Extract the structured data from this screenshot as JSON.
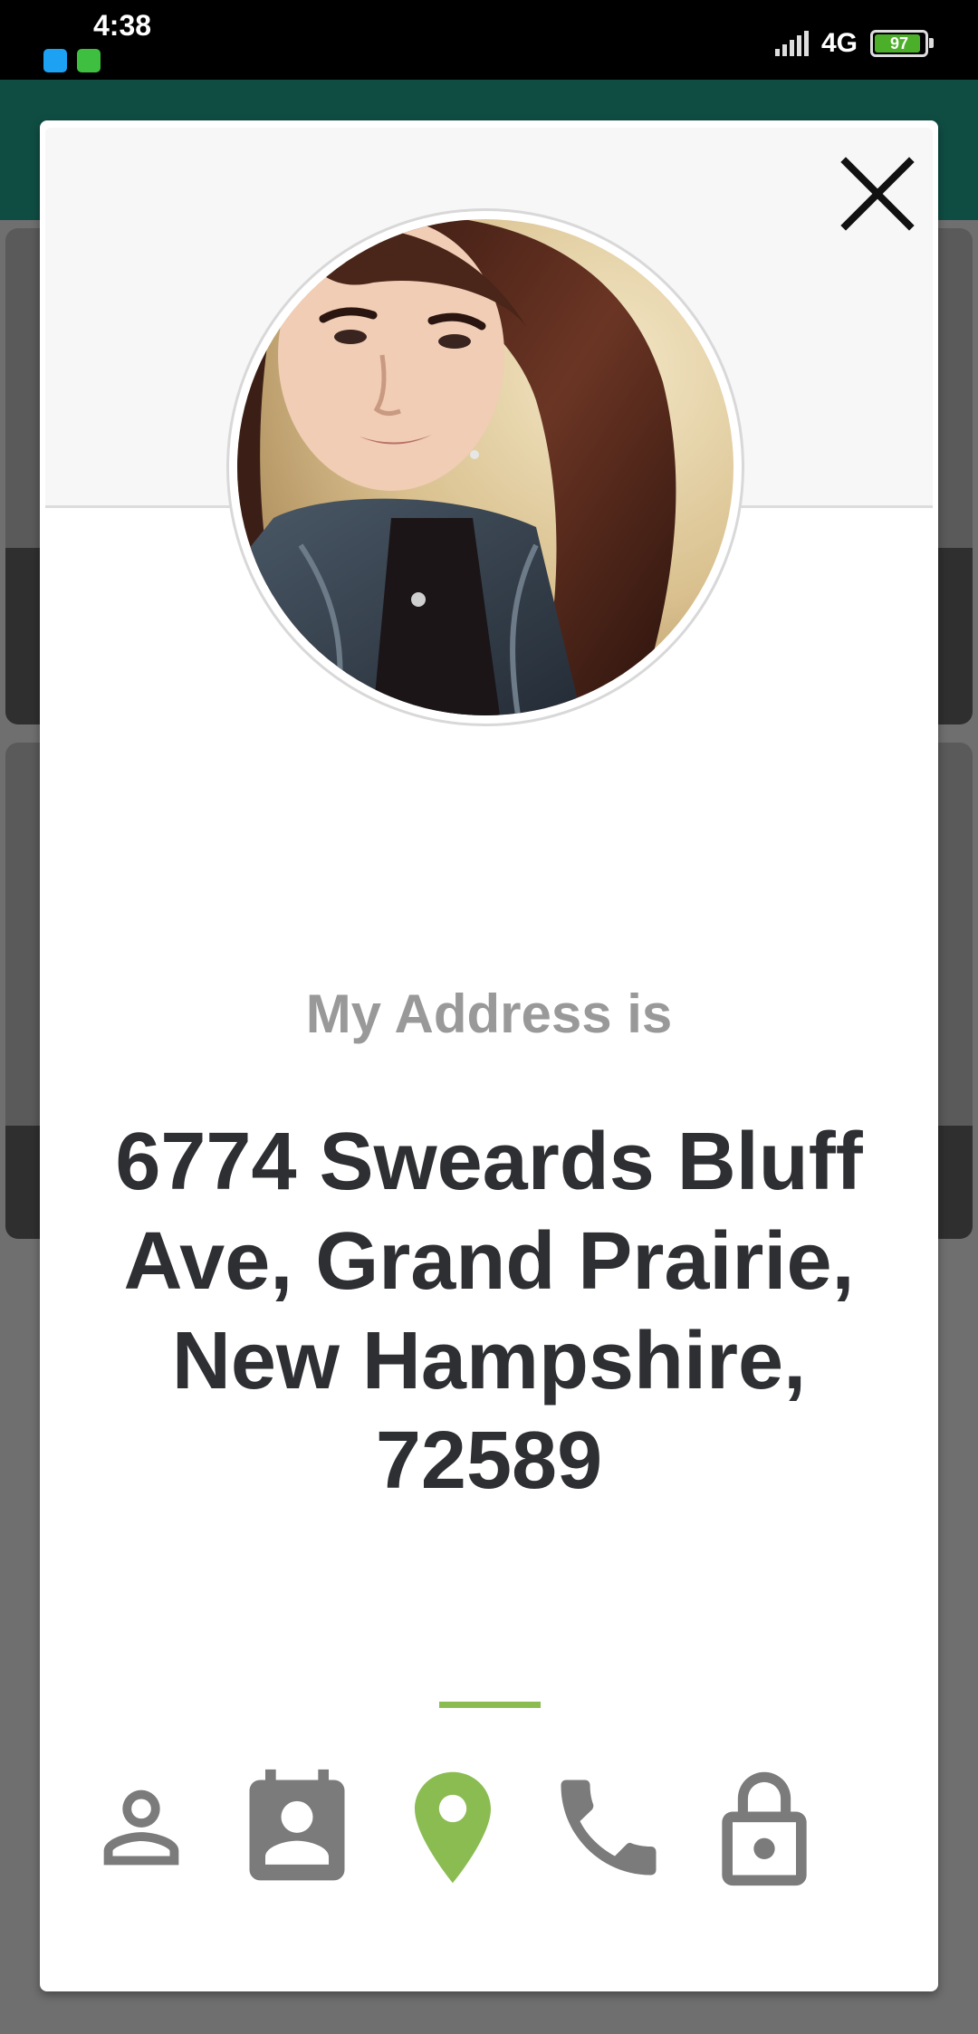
{
  "status_bar": {
    "time": "4:38",
    "network": "4G",
    "battery": "97"
  },
  "modal": {
    "label": "My Address is",
    "value": "6774 Sweards Bluff Ave, Grand Prairie, New Hampshire, 72589",
    "active_tab": "location",
    "tabs": [
      {
        "name": "name",
        "icon": "person-outline-icon"
      },
      {
        "name": "birthday",
        "icon": "contact-calendar-icon"
      },
      {
        "name": "location",
        "icon": "location-pin-icon"
      },
      {
        "name": "phone",
        "icon": "phone-icon"
      },
      {
        "name": "password",
        "icon": "lock-icon"
      }
    ]
  },
  "colors": {
    "accent": "#8bbc52",
    "icon_inactive": "#7b7b7b",
    "label": "#999999",
    "value": "#2e2f33"
  }
}
